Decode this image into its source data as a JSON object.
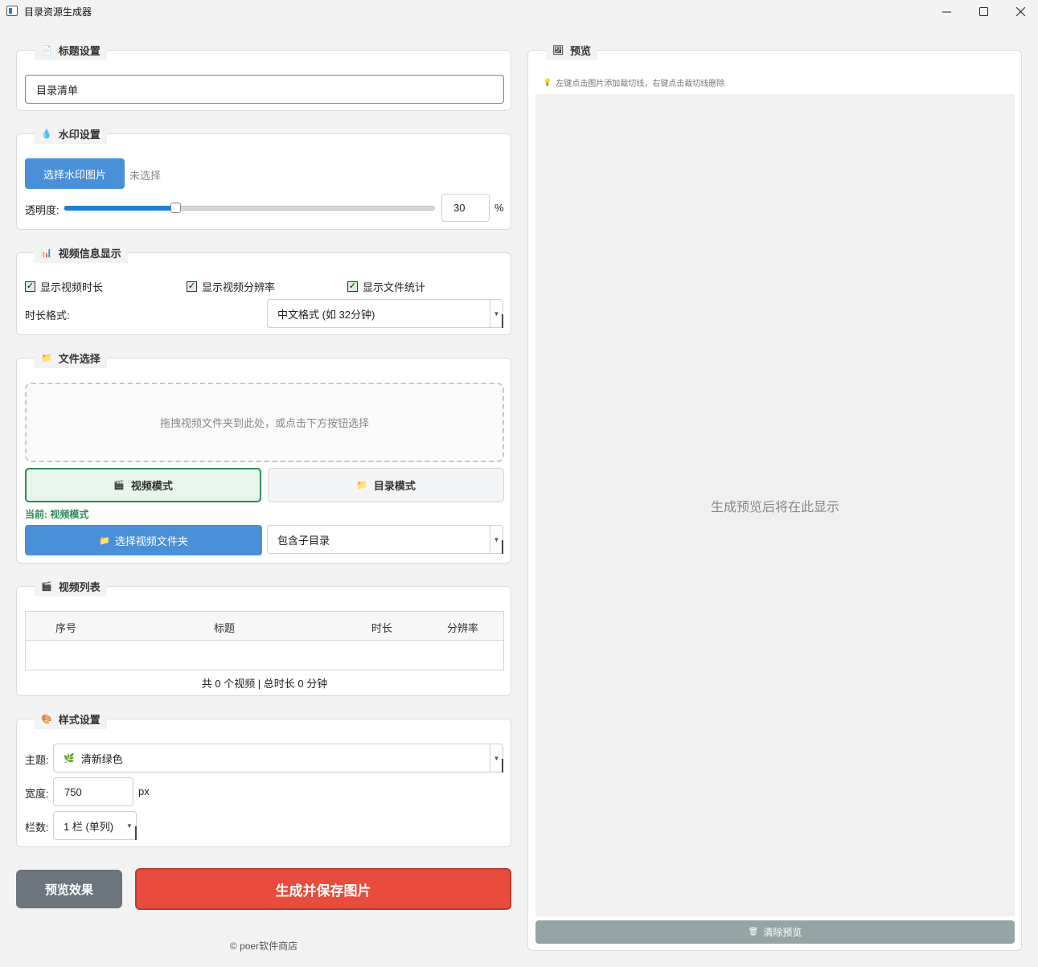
{
  "window": {
    "title": "目录资源生成器",
    "min_icon": "minimize-icon",
    "max_icon": "maximize-icon",
    "close_icon": "close-icon"
  },
  "title_settings": {
    "heading": "标题设置",
    "value": "目录清单"
  },
  "watermark": {
    "heading": "水印设置",
    "select_button": "选择水印图片",
    "status": "未选择",
    "opacity_label": "透明度:",
    "opacity_value": "30",
    "opacity_percent": 30,
    "unit": "%"
  },
  "video_info": {
    "heading": "视频信息显示",
    "show_duration": "显示视频时长",
    "show_resolution": "显示视频分辨率",
    "show_stats": "显示文件统计",
    "duration_format_label": "时长格式:",
    "duration_format_value": "中文格式 (如 32分钟)"
  },
  "file_select": {
    "heading": "文件选择",
    "drop_hint": "拖拽视频文件夹到此处，或点击下方按钮选择",
    "video_mode": "视频模式",
    "dir_mode": "目录模式",
    "current_prefix": "当前: ",
    "current_value": "视频模式",
    "select_folder": "选择视频文件夹",
    "subdir_option": "包含子目录"
  },
  "video_list": {
    "heading": "视频列表",
    "columns": [
      "序号",
      "标题",
      "时长",
      "分辨率"
    ],
    "summary": "共 0 个视频 | 总时长 0 分钟"
  },
  "style": {
    "heading": "样式设置",
    "theme_label": "主题:",
    "theme_value": "清新绿色",
    "width_label": "宽度:",
    "width_value": "750",
    "width_unit": "px",
    "columns_label": "栏数:",
    "columns_value": "1 栏 (单列)"
  },
  "actions": {
    "preview": "预览效果",
    "generate": "生成并保存图片"
  },
  "footer": {
    "copyright": "© poer软件商店"
  },
  "preview": {
    "heading": "预览",
    "hint": "左键点击图片添加裁切线，右键点击裁切线删除",
    "placeholder": "生成预览后将在此显示",
    "clear": "清除预览"
  },
  "colors": {
    "accent": "#4a90d9",
    "danger": "#e74c3c",
    "green": "#2e8b57",
    "gray_button": "#6c757d"
  }
}
